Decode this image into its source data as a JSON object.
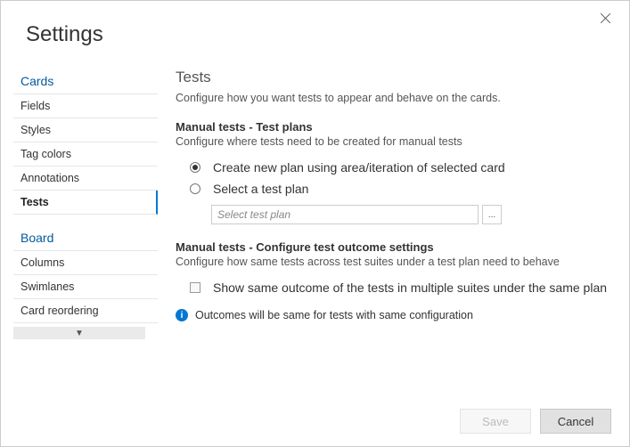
{
  "title": "Settings",
  "sidebar": {
    "groups": [
      {
        "header": "Cards",
        "items": [
          {
            "label": "Fields",
            "active": false
          },
          {
            "label": "Styles",
            "active": false
          },
          {
            "label": "Tag colors",
            "active": false
          },
          {
            "label": "Annotations",
            "active": false
          },
          {
            "label": "Tests",
            "active": true
          }
        ]
      },
      {
        "header": "Board",
        "items": [
          {
            "label": "Columns",
            "active": false
          },
          {
            "label": "Swimlanes",
            "active": false
          },
          {
            "label": "Card reordering",
            "active": false
          }
        ]
      }
    ]
  },
  "content": {
    "section_title": "Tests",
    "section_desc": "Configure how you want tests to appear and behave on the cards.",
    "manual_plans": {
      "title": "Manual tests - Test plans",
      "desc": "Configure where tests need to be created for manual tests",
      "option_create": "Create new plan using area/iteration of selected card",
      "option_select": "Select a test plan",
      "plan_placeholder": "Select test plan",
      "browse_label": "..."
    },
    "outcome": {
      "title": "Manual tests - Configure test outcome settings",
      "desc": "Configure how same tests across test suites under a test plan need to behave",
      "checkbox_label": "Show same outcome of the tests in multiple suites under the same plan",
      "info_text": "Outcomes will be same for tests with same configuration"
    }
  },
  "footer": {
    "save": "Save",
    "cancel": "Cancel"
  }
}
